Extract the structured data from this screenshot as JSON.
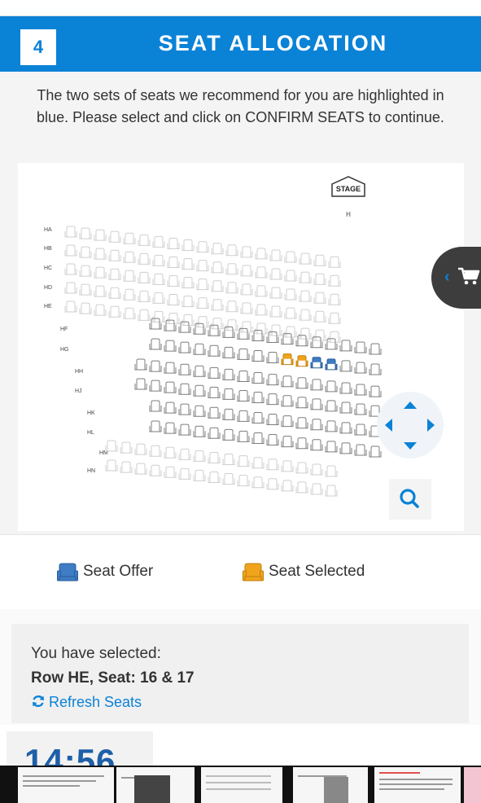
{
  "header": {
    "step_number": "4",
    "title": "SEAT ALLOCATION"
  },
  "intro": {
    "text": "The two sets of seats we recommend for you are highlighted in blue. Please select and click on CONFIRM SEATS to continue."
  },
  "seat_map": {
    "stage_label": "STAGE",
    "stage_row_label": "H",
    "rows": [
      {
        "label": "HA",
        "seats": 19,
        "status": "unavailable"
      },
      {
        "label": "HB",
        "seats": 19,
        "status": "unavailable"
      },
      {
        "label": "HC",
        "seats": 19,
        "status": "unavailable"
      },
      {
        "label": "HD",
        "seats": 19,
        "status": "unavailable"
      },
      {
        "label": "HE",
        "seats": 19,
        "status": "unavailable"
      },
      {
        "label": "HF",
        "seats": 16,
        "status": "available"
      },
      {
        "label": "HG",
        "seats": 16,
        "status": "available"
      },
      {
        "label": "HH",
        "seats": 17,
        "status": "available"
      },
      {
        "label": "HJ",
        "seats": 17,
        "status": "available"
      },
      {
        "label": "HK",
        "seats": 16,
        "status": "available"
      },
      {
        "label": "HL",
        "seats": 16,
        "status": "available"
      },
      {
        "label": "HM",
        "seats": 16,
        "status": "unavailable"
      },
      {
        "label": "HN",
        "seats": 16,
        "status": "unavailable"
      }
    ],
    "selected_seats": [
      {
        "row": "HG",
        "seats": [
          10,
          11
        ]
      }
    ],
    "offered_seats": [
      {
        "row": "HG",
        "seats": [
          12,
          13
        ]
      }
    ],
    "colors": {
      "available": "#7d7d7d",
      "unavailable": "#cfcfcf",
      "offer": "#3e7cc4",
      "selected": "#f0a41c"
    }
  },
  "controls": {
    "cart_icon": "shopping-cart-icon",
    "collapse_icon": "chevron-left-icon",
    "pan_icons": [
      "arrow-up-icon",
      "arrow-down-icon",
      "arrow-left-icon",
      "arrow-right-icon"
    ],
    "zoom_icon": "search-icon"
  },
  "legend": {
    "offer_label": "Seat Offer",
    "selected_label": "Seat Selected"
  },
  "selection": {
    "label": "You have selected:",
    "value": "Row HE, Seat: 16 & 17",
    "refresh_label": "Refresh Seats"
  },
  "timer": {
    "value": "14:56"
  },
  "brand_color": "#0a82d6"
}
